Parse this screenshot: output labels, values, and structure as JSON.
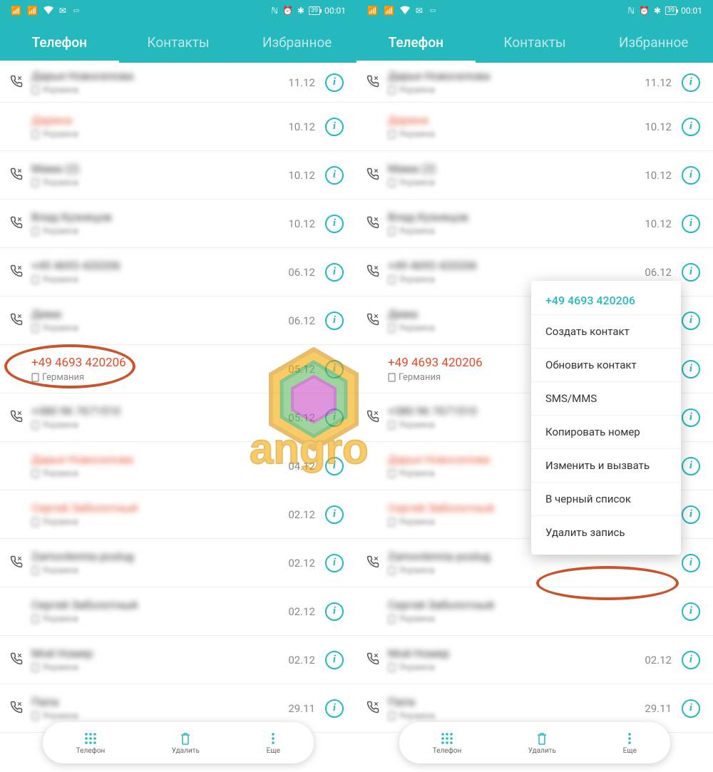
{
  "status": {
    "battery": "39",
    "time": "00:01"
  },
  "tabs": {
    "phone": "Телефон",
    "contacts": "Контакты",
    "favorites": "Избранное"
  },
  "highlighted": {
    "number": "+49 4693 420206",
    "country": "Германия"
  },
  "calls": [
    {
      "name": "Дарья Новоселова",
      "red": false,
      "date": "11.12",
      "icon": true
    },
    {
      "name": "Дарина",
      "red": true,
      "date": "10.12",
      "icon": false
    },
    {
      "name": "Мама (2)",
      "red": false,
      "date": "10.12",
      "icon": true
    },
    {
      "name": "Влад Кузнецов",
      "red": false,
      "date": "10.12",
      "icon": true
    },
    {
      "name": "+49 4693 420206",
      "red": false,
      "date": "06.12",
      "icon": true
    },
    {
      "name": "Дима",
      "red": false,
      "date": "06.12",
      "icon": true
    },
    {
      "name": "—",
      "red": false,
      "date": "05.12",
      "icon": false,
      "clear": true
    },
    {
      "name": "+380 96 7671510",
      "red": false,
      "date": "05.12",
      "icon": true
    },
    {
      "name": "Дарья Новоселова",
      "red": true,
      "date": "04.12",
      "icon": false
    },
    {
      "name": "Сергей Заболотный",
      "red": true,
      "date": "02.12",
      "icon": false
    },
    {
      "name": "Zamovlennia poslug",
      "red": false,
      "date": "02.12",
      "icon": true
    },
    {
      "name": "Сергей Заболотный",
      "red": false,
      "date": "02.12",
      "icon": false
    },
    {
      "name": "Мой Номер",
      "red": false,
      "date": "02.12",
      "icon": true
    },
    {
      "name": "Папа",
      "red": false,
      "date": "29.11",
      "icon": true
    }
  ],
  "calls_right": [
    {
      "name": "Дарья Новоселова",
      "red": false,
      "date": "11.12",
      "icon": true
    },
    {
      "name": "Дарина",
      "red": true,
      "date": "10.12",
      "icon": false
    },
    {
      "name": "Мама (2)",
      "red": false,
      "date": "10.12",
      "icon": true
    },
    {
      "name": "Влад Кузнецов",
      "red": false,
      "date": "10.12",
      "icon": true
    },
    {
      "name": "+49 4693 420206",
      "red": false,
      "date": "06.12",
      "icon": true
    },
    {
      "name": "Дима",
      "red": false,
      "date": "",
      "icon": true
    },
    {
      "name": "+49 4693 420206",
      "red": true,
      "date": "",
      "icon": false,
      "clear": true
    },
    {
      "name": "+380 96 7671510",
      "red": false,
      "date": "",
      "icon": true
    },
    {
      "name": "Дарья Новоселова",
      "red": true,
      "date": "",
      "icon": false
    },
    {
      "name": "Сергей Заболотный",
      "red": true,
      "date": "",
      "icon": false
    },
    {
      "name": "Zamovlennia poslug",
      "red": false,
      "date": "",
      "icon": true
    },
    {
      "name": "Сергей Заболотный",
      "red": false,
      "date": "",
      "icon": false
    },
    {
      "name": "Мой Номер",
      "red": false,
      "date": "02.12",
      "icon": true
    },
    {
      "name": "Папа",
      "red": false,
      "date": "29.11",
      "icon": true
    }
  ],
  "bottom": {
    "phone": "Телефон",
    "delete": "Удалить",
    "more": "Еще"
  },
  "menu": {
    "header": "+49 4693 420206",
    "create": "Создать контакт",
    "update": "Обновить контакт",
    "sms": "SMS/MMS",
    "copy": "Копировать номер",
    "edit": "Изменить и вызвать",
    "blacklist": "В черный список",
    "del": "Удалить запись"
  }
}
